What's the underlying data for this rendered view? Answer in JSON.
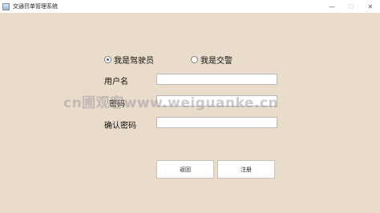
{
  "window": {
    "title": "交通罚单管理系统",
    "minimize_glyph": "—",
    "maximize_glyph": "☐",
    "close_glyph": "✕"
  },
  "role": {
    "options": [
      {
        "label": "我是驾驶员",
        "checked": true
      },
      {
        "label": "我是交警",
        "checked": false
      }
    ]
  },
  "form": {
    "username_label": "用户名",
    "password_label": "密码",
    "confirm_label": "确认密码",
    "username_value": "",
    "password_value": "",
    "confirm_value": ""
  },
  "buttons": {
    "back_label": "返回",
    "register_label": "注册"
  },
  "watermark": "cn圃观客www.weiguanke.cn"
}
